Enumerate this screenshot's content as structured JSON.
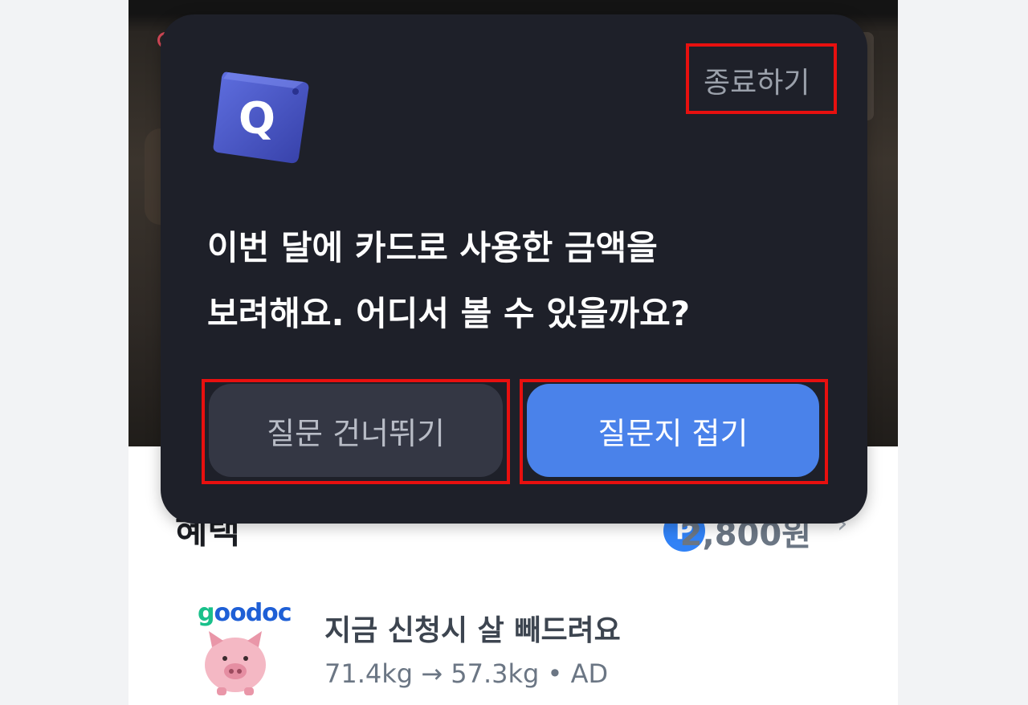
{
  "background": {
    "section_title": "혜택",
    "points": {
      "icon": "P",
      "amount": "2,800원"
    },
    "ad": {
      "brand_logo": "goodoc",
      "title": "지금 신청시 살 빼드려요",
      "meta": "71.4kg → 57.3kg • AD"
    }
  },
  "dialog": {
    "app_icon": "Q",
    "close_label": "종료하기",
    "question_line1": "이번 달에 카드로 사용한 금액을",
    "question_line2": "보려해요. 어디서 볼 수 있을까요?",
    "skip_button": "질문 건너뛰기",
    "fold_button": "질문지 접기"
  },
  "colors": {
    "dialog_bg": "#1e2029",
    "primary_button": "#4a82ea",
    "secondary_button": "#343744",
    "highlight": "#e8100f"
  }
}
